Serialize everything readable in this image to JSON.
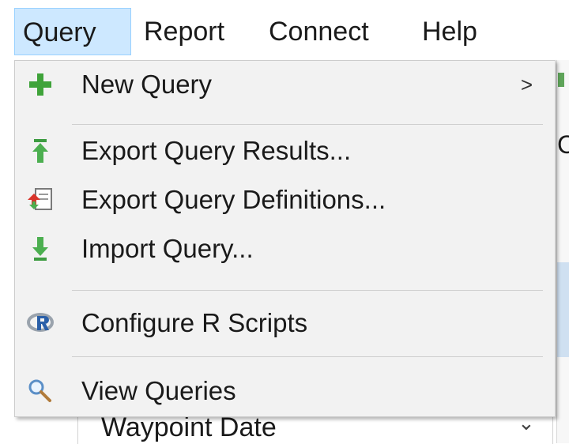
{
  "menubar": {
    "items": [
      {
        "label": "Query"
      },
      {
        "label": "Report"
      },
      {
        "label": "Connect"
      },
      {
        "label": "Help"
      }
    ]
  },
  "dropdown": {
    "new_query": {
      "label": "New Query",
      "submenu_arrow": ">",
      "icon": "plus-icon"
    },
    "export_results": {
      "label": "Export Query Results...",
      "icon": "export-arrow-up-icon"
    },
    "export_definitions": {
      "label": "Export Query Definitions...",
      "icon": "export-definitions-icon"
    },
    "import_query": {
      "label": "Import Query...",
      "icon": "import-arrow-down-icon"
    },
    "configure_r": {
      "label": "Configure R Scripts",
      "icon": "r-logo-icon"
    },
    "view_queries": {
      "label": "View Queries",
      "icon": "magnifier-icon"
    }
  },
  "background": {
    "partial_field": "Waypoint Date",
    "partial_letter": "C"
  },
  "colors": {
    "active_menu_bg": "#cde8ff",
    "active_menu_border": "#99d1ff",
    "menu_bg": "#f2f2f2",
    "plus_green": "#3fa33a",
    "arrow_green": "#4caf50",
    "r_blue": "#2a5fa8"
  }
}
